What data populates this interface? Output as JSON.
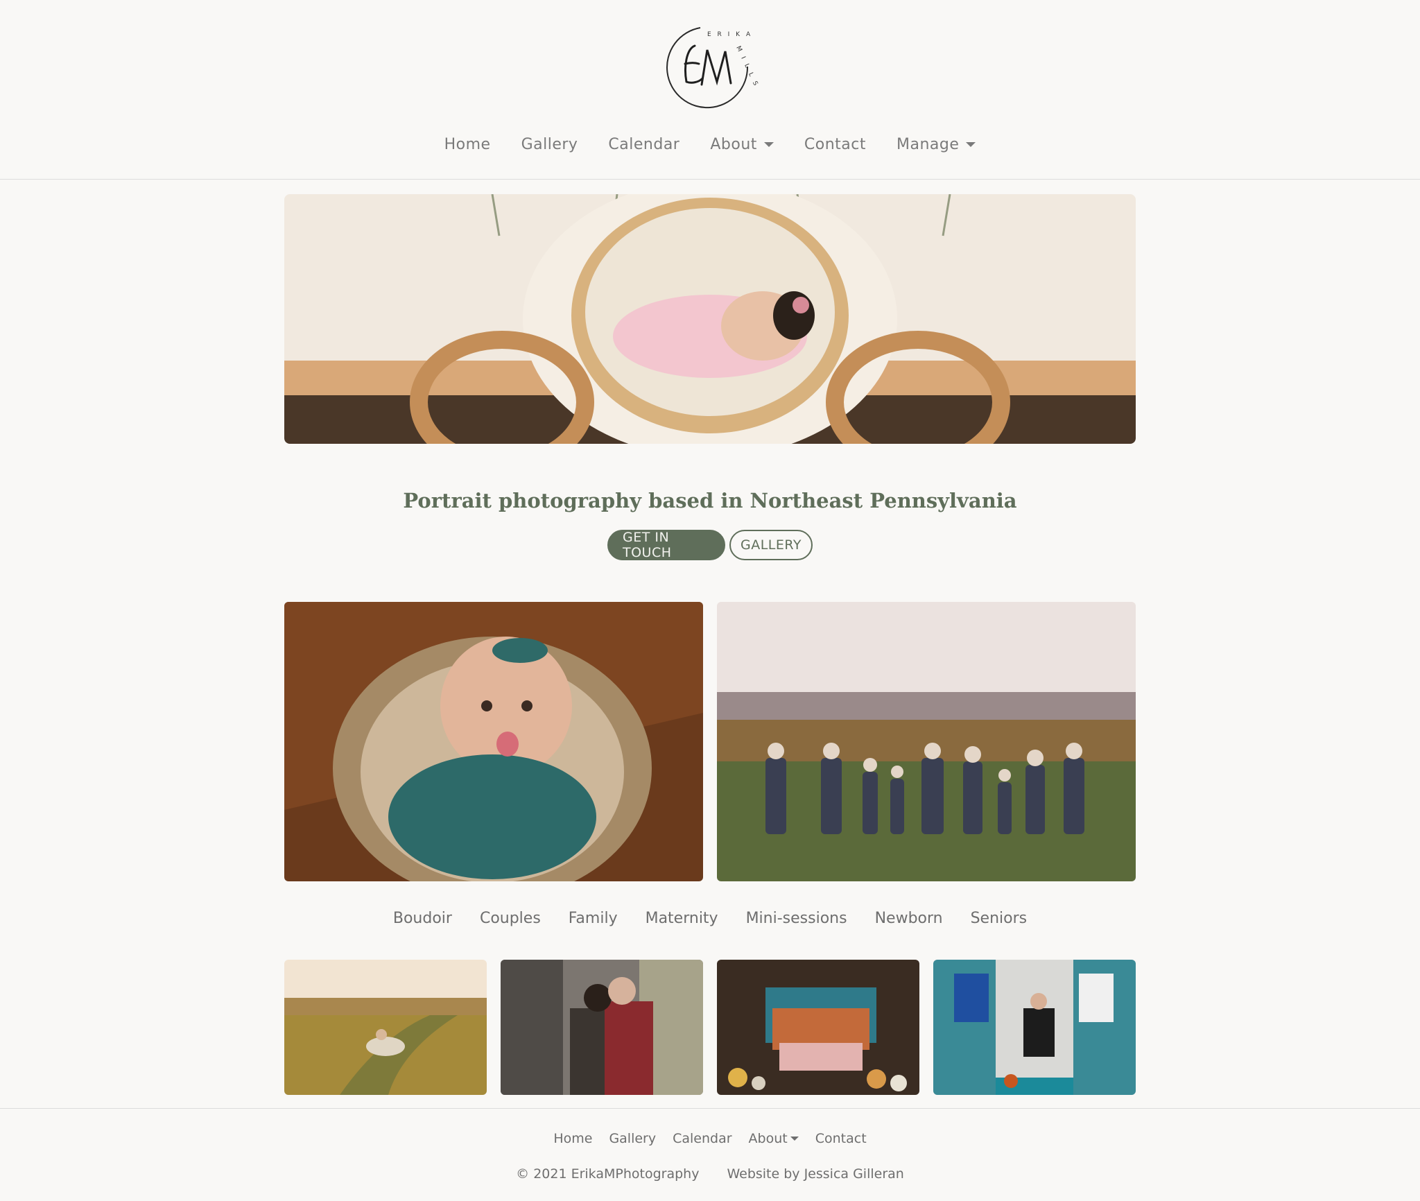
{
  "brand": {
    "logo_text": "EM",
    "logo_ring_text": "ERIKA MILLS"
  },
  "nav": {
    "items": [
      {
        "label": "Home",
        "dropdown": false
      },
      {
        "label": "Gallery",
        "dropdown": false
      },
      {
        "label": "Calendar",
        "dropdown": false
      },
      {
        "label": "About",
        "dropdown": true
      },
      {
        "label": "Contact",
        "dropdown": false
      },
      {
        "label": "Manage",
        "dropdown": true
      }
    ]
  },
  "hero": {
    "image": "newborn-in-carriage-photo"
  },
  "main": {
    "tagline": "Portrait photography based in Northeast Pennsylvania",
    "cta_primary": "GET IN TOUCH",
    "cta_secondary": "GALLERY"
  },
  "featured": [
    {
      "image": "newborn-in-basket-photo"
    },
    {
      "image": "family-in-field-photo"
    }
  ],
  "categories": [
    "Boudoir",
    "Couples",
    "Family",
    "Maternity",
    "Mini-sessions",
    "Newborn",
    "Seniors"
  ],
  "thumbnails": [
    {
      "image": "couple-in-meadow-photo"
    },
    {
      "image": "couple-embracing-photo"
    },
    {
      "image": "family-truck-pumpkins-photo"
    },
    {
      "image": "senior-locker-room-photo"
    }
  ],
  "footer": {
    "nav": [
      {
        "label": "Home",
        "dropdown": false
      },
      {
        "label": "Gallery",
        "dropdown": false
      },
      {
        "label": "Calendar",
        "dropdown": false
      },
      {
        "label": "About",
        "dropdown": true
      },
      {
        "label": "Contact",
        "dropdown": false
      }
    ],
    "copyright": "© 2021 ErikaMPhotography",
    "credit": "Website by Jessica Gilleran"
  },
  "colors": {
    "background": "#f9f8f6",
    "accent": "#5f6e5a",
    "text": "#6b6b6b"
  }
}
